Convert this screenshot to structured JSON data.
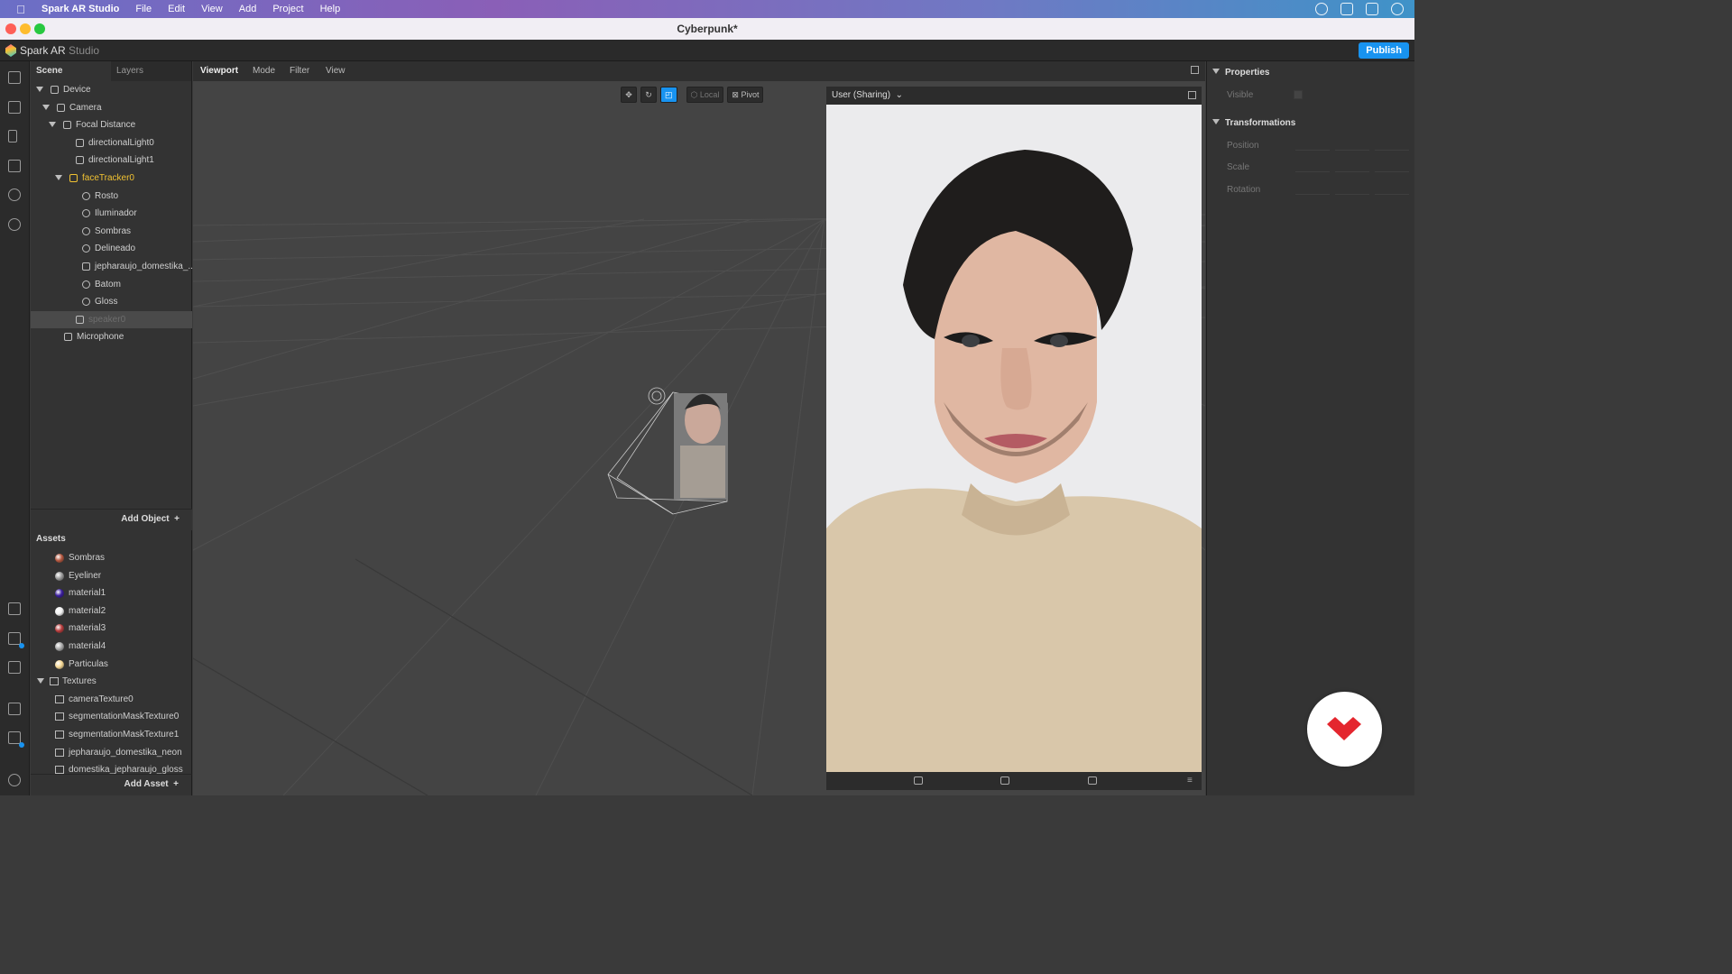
{
  "menubar": {
    "app": "Spark AR Studio",
    "items": [
      "File",
      "Edit",
      "View",
      "Add",
      "Project",
      "Help"
    ]
  },
  "window": {
    "title": "Cyberpunk*"
  },
  "header": {
    "app_name_main": "Spark AR",
    "app_name_sub": "Studio",
    "publish": "Publish"
  },
  "scene": {
    "tabs": [
      "Scene",
      "Layers"
    ],
    "tree": [
      {
        "label": "Device",
        "icon": "device-icon"
      },
      {
        "label": "Camera",
        "icon": "camera-icon"
      },
      {
        "label": "Focal Distance",
        "icon": "focal-distance-icon"
      },
      {
        "label": "directionalLight0",
        "icon": "light-icon"
      },
      {
        "label": "directionalLight1",
        "icon": "light-icon"
      },
      {
        "label": "faceTracker0",
        "icon": "face-tracker-icon"
      },
      {
        "label": "Rosto",
        "icon": "face-mesh-icon"
      },
      {
        "label": "Iluminador",
        "icon": "face-mesh-icon"
      },
      {
        "label": "Sombras",
        "icon": "face-mesh-icon"
      },
      {
        "label": "Delineado",
        "icon": "face-mesh-icon"
      },
      {
        "label": "jepharaujo_domestika_...",
        "icon": "3d-object-icon"
      },
      {
        "label": "Batom",
        "icon": "face-mesh-icon"
      },
      {
        "label": "Gloss",
        "icon": "face-mesh-icon"
      },
      {
        "label": "speaker0",
        "icon": "speaker-icon"
      },
      {
        "label": "Microphone",
        "icon": "microphone-icon"
      }
    ],
    "add_object": "Add Object"
  },
  "assets": {
    "title": "Assets",
    "materials": [
      {
        "label": "Sombras",
        "color": "#b5573f"
      },
      {
        "label": "Eyeliner",
        "color": "#9a9a9a"
      },
      {
        "label": "material1",
        "color": "#3a1d9e"
      },
      {
        "label": "material2",
        "color": "#f2f2f2"
      },
      {
        "label": "material3",
        "color": "#b83c3c"
      },
      {
        "label": "material4",
        "color": "#a9a9a9"
      },
      {
        "label": "Particulas",
        "color": "#f6d894"
      }
    ],
    "textures_folder": "Textures",
    "textures": [
      "cameraTexture0",
      "segmentationMaskTexture0",
      "segmentationMaskTexture1",
      "jepharaujo_domestika_neon",
      "domestika_jepharaujo_gloss"
    ],
    "add_asset": "Add Asset"
  },
  "viewport": {
    "tabs": [
      "Viewport",
      "Mode",
      "Filter",
      "View"
    ],
    "local_label": "Local",
    "pivot_label": "Pivot"
  },
  "simulator": {
    "device": "User (Sharing)"
  },
  "properties": {
    "title": "Properties",
    "visible_label": "Visible",
    "transformations_title": "Transformations",
    "rows": [
      "Position",
      "Scale",
      "Rotation"
    ]
  }
}
